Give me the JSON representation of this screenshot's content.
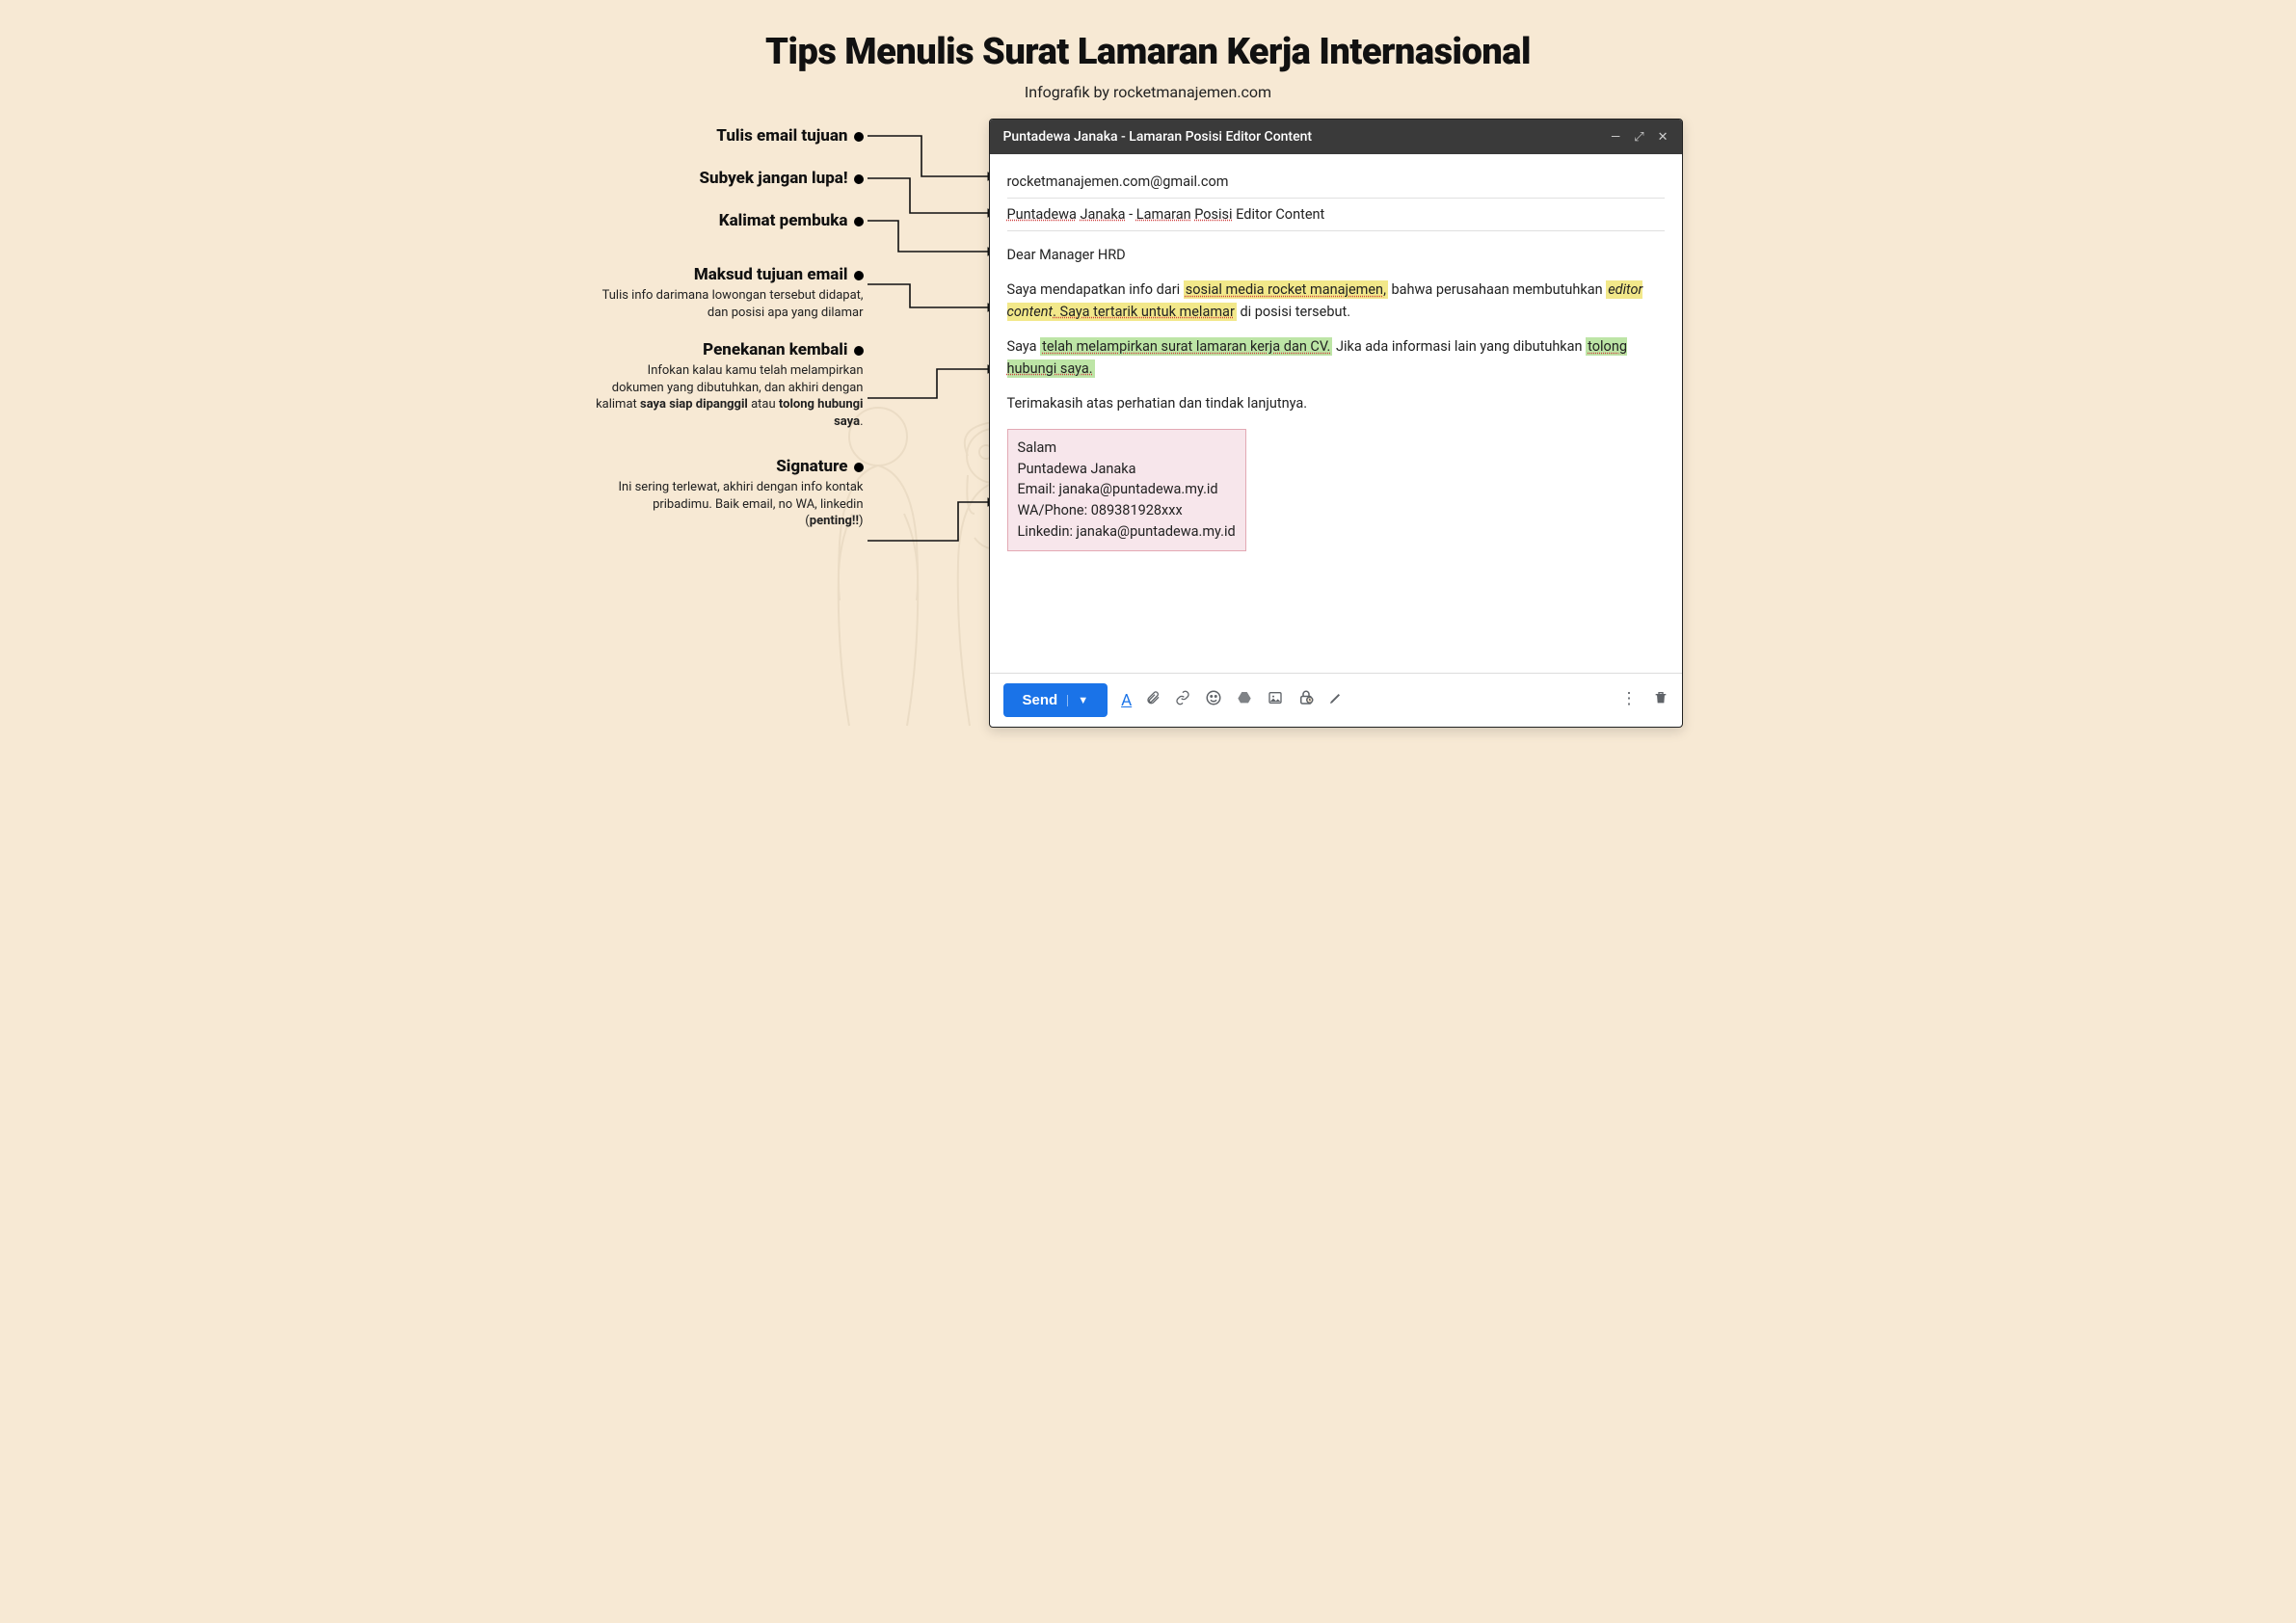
{
  "title": "Tips Menulis Surat Lamaran Kerja Internasional",
  "subtitle": "Infografik by rocketmanajemen.com",
  "annotations": {
    "a1": {
      "title": "Tulis email tujuan"
    },
    "a2": {
      "title": "Subyek jangan lupa!"
    },
    "a3": {
      "title": "Kalimat pembuka"
    },
    "a4": {
      "title": "Maksud tujuan email",
      "desc_plain": "Tulis info darimana lowongan tersebut didapat, dan posisi apa yang dilamar"
    },
    "a5": {
      "title": "Penekanan kembali",
      "desc_pre": "Infokan kalau kamu telah melampirkan dokumen yang dibutuhkan, dan akhiri dengan kalimat ",
      "desc_b1": "saya siap dipanggil",
      "desc_mid": " atau ",
      "desc_b2": "tolong hubungi saya",
      "desc_end": "."
    },
    "a6": {
      "title": "Signature",
      "desc_pre": "Ini sering terlewat, akhiri dengan info kontak pribadimu. Baik email, no WA, linkedin (",
      "desc_b": "penting!!",
      "desc_end": ")"
    }
  },
  "email": {
    "window_title": "Puntadewa Janaka - Lamaran Posisi Editor Content",
    "to": "rocketmanajemen.com@gmail.com",
    "subject_u1": "Puntadewa",
    "subject_sp1": " ",
    "subject_u2": "Janaka",
    "subject_mid": " - ",
    "subject_u3": "Lamaran",
    "subject_sp2": " ",
    "subject_u4": "Posisi",
    "subject_tail": " Editor Content",
    "greeting": "Dear Manager HRD",
    "p1_a": "Saya mendapatkan info dari ",
    "p1_hl1": "sosial media rocket manajemen,",
    "p1_b": " bahwa perusahaan membutuhkan ",
    "p1_hl2_i": "editor content",
    "p1_hl2_rest": ". Saya tertarik untuk melamar",
    "p1_c": " di posisi tersebut.",
    "p2_a": "Saya ",
    "p2_hl1": "telah melampirkan surat lamaran kerja dan CV.",
    "p2_b": " Jika ada informasi lain yang dibutuhkan ",
    "p2_hl2": "tolong hubungi saya.",
    "p3": "Terimakasih atas perhatian dan tindak lanjutnya.",
    "sig": {
      "l1": "Salam",
      "l2": "Puntadewa Janaka",
      "l3": "Email: janaka@puntadewa.my.id",
      "l4": "WA/Phone: 089381928xxx",
      "l5": "Linkedin: janaka@puntadewa.my.id"
    },
    "send": "Send"
  }
}
